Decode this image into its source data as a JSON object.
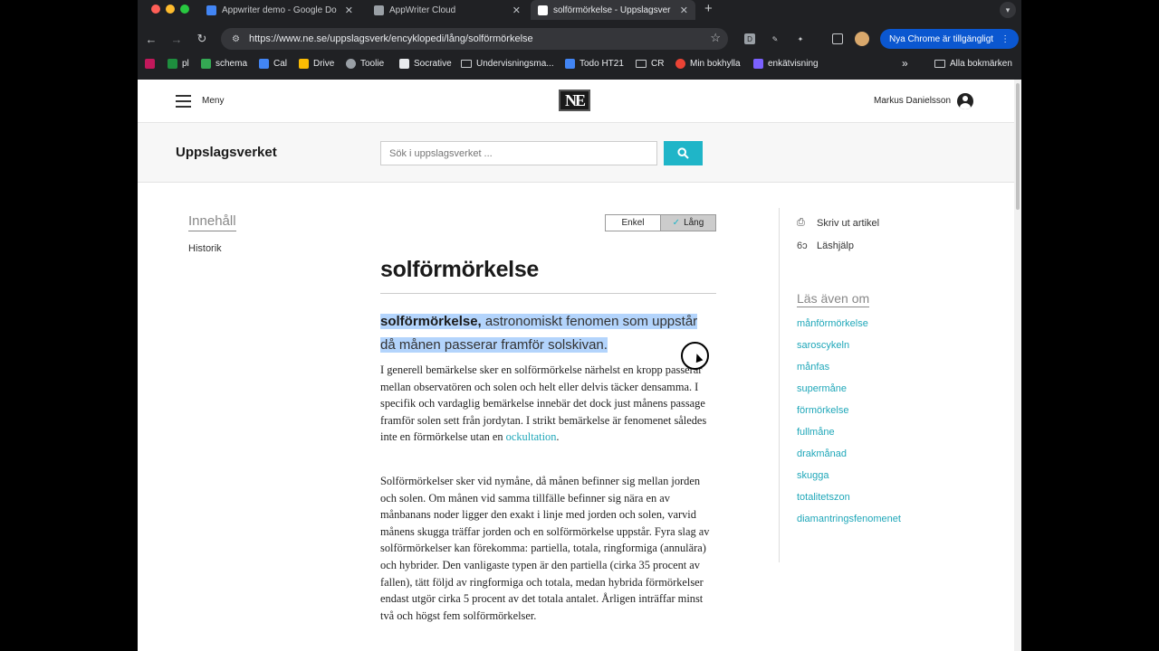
{
  "browser": {
    "tabs": [
      {
        "title": "Appwriter demo - Google Do",
        "close": "✕",
        "icon_color": "#4285f4"
      },
      {
        "title": "AppWriter Cloud",
        "close": "✕",
        "icon_color": "#9aa0a6"
      },
      {
        "title": "solförmörkelse - Uppslagsver",
        "close": "✕",
        "icon_color": "#ffffff",
        "icon_text": "NE"
      }
    ],
    "new_tab": "+",
    "url": "https://www.ne.se/uppslagsverk/encyklopedi/lång/solförmörkelse",
    "update_button": "Nya Chrome är tillgängligt",
    "bookmarks": [
      {
        "label": "pl",
        "icon_color": "#1e8e3e"
      },
      {
        "label": "schema",
        "icon_color": "#34a853"
      },
      {
        "label": "Cal",
        "icon_color": "#4285f4"
      },
      {
        "label": "Drive",
        "icon_color": "#fbbc04"
      },
      {
        "label": "Toolie",
        "icon_color": "#9aa0a6"
      },
      {
        "label": "Socrative",
        "icon_color": "#e8eaed"
      },
      {
        "label": "Undervisningsma...",
        "icon_color": "folder"
      },
      {
        "label": "Todo HT21",
        "icon_color": "#4285f4"
      },
      {
        "label": "CR",
        "icon_color": "folder"
      },
      {
        "label": "Min bokhylla",
        "icon_color": "#ea4335"
      },
      {
        "label": "enkätvisning",
        "icon_color": "#7b61ff"
      }
    ],
    "bookmarks_more": "»",
    "all_bookmarks": "Alla bokmärken"
  },
  "site": {
    "menu_label": "Meny",
    "logo": "NE",
    "user_name": "Markus Danielsson",
    "brand": "Uppslagsverket",
    "search_placeholder": "Sök i uppslagsverket ..."
  },
  "toc": {
    "title": "Innehåll",
    "items": [
      "Historik"
    ]
  },
  "view_toggle": {
    "short": "Enkel",
    "long": "Lång",
    "check": "✓"
  },
  "article": {
    "title": "solförmörkelse",
    "lead_term": "solförmörkelse,",
    "lead_rest": " astronomiskt fenomen som uppstår då månen passerar framför solskivan.",
    "p1_text": "I generell bemärkelse sker en solförmörkelse närhelst en kropp passerar mellan observatören och solen och helt eller delvis täcker densamma. I specifik och vardaglig bemärkelse innebär det dock just månens passage framför solen sett från jordytan. I strikt bemärkelse är fenomenet således inte en förmörkelse utan en ",
    "p1_link": "ockultation",
    "p1_end": ".",
    "p2_text": "Solförmörkelser sker vid nymåne, då månen befinner sig mellan jorden och solen. Om månen vid samma tillfälle befinner sig nära en av månbanans noder ligger den exakt i linje med jorden och solen, varvid månens skugga träffar jorden och en solförmörkelse uppstår. Fyra slag av solförmörkelser kan förekomma: partiella, totala, ringformiga (annulära) och hybrider. Den vanligaste typen är den partiella (cirka 35 procent av fallen), tätt följd av ringformiga och totala, medan hybrida förmörkelser endast utgör cirka 5 procent av det totala antalet. Årligen inträffar minst två och högst fem solförmörkelser."
  },
  "tools": {
    "print": "Skriv ut artikel",
    "reading_help": "Läshjälp"
  },
  "related": {
    "title": "Läs även om",
    "items": [
      "månförmörkelse",
      "saroscykeln",
      "månfas",
      "supermåne",
      "förmörkelse",
      "fullmåne",
      "drakmånad",
      "skugga",
      "totalitetszon",
      "diamantringsfenomenet"
    ]
  }
}
